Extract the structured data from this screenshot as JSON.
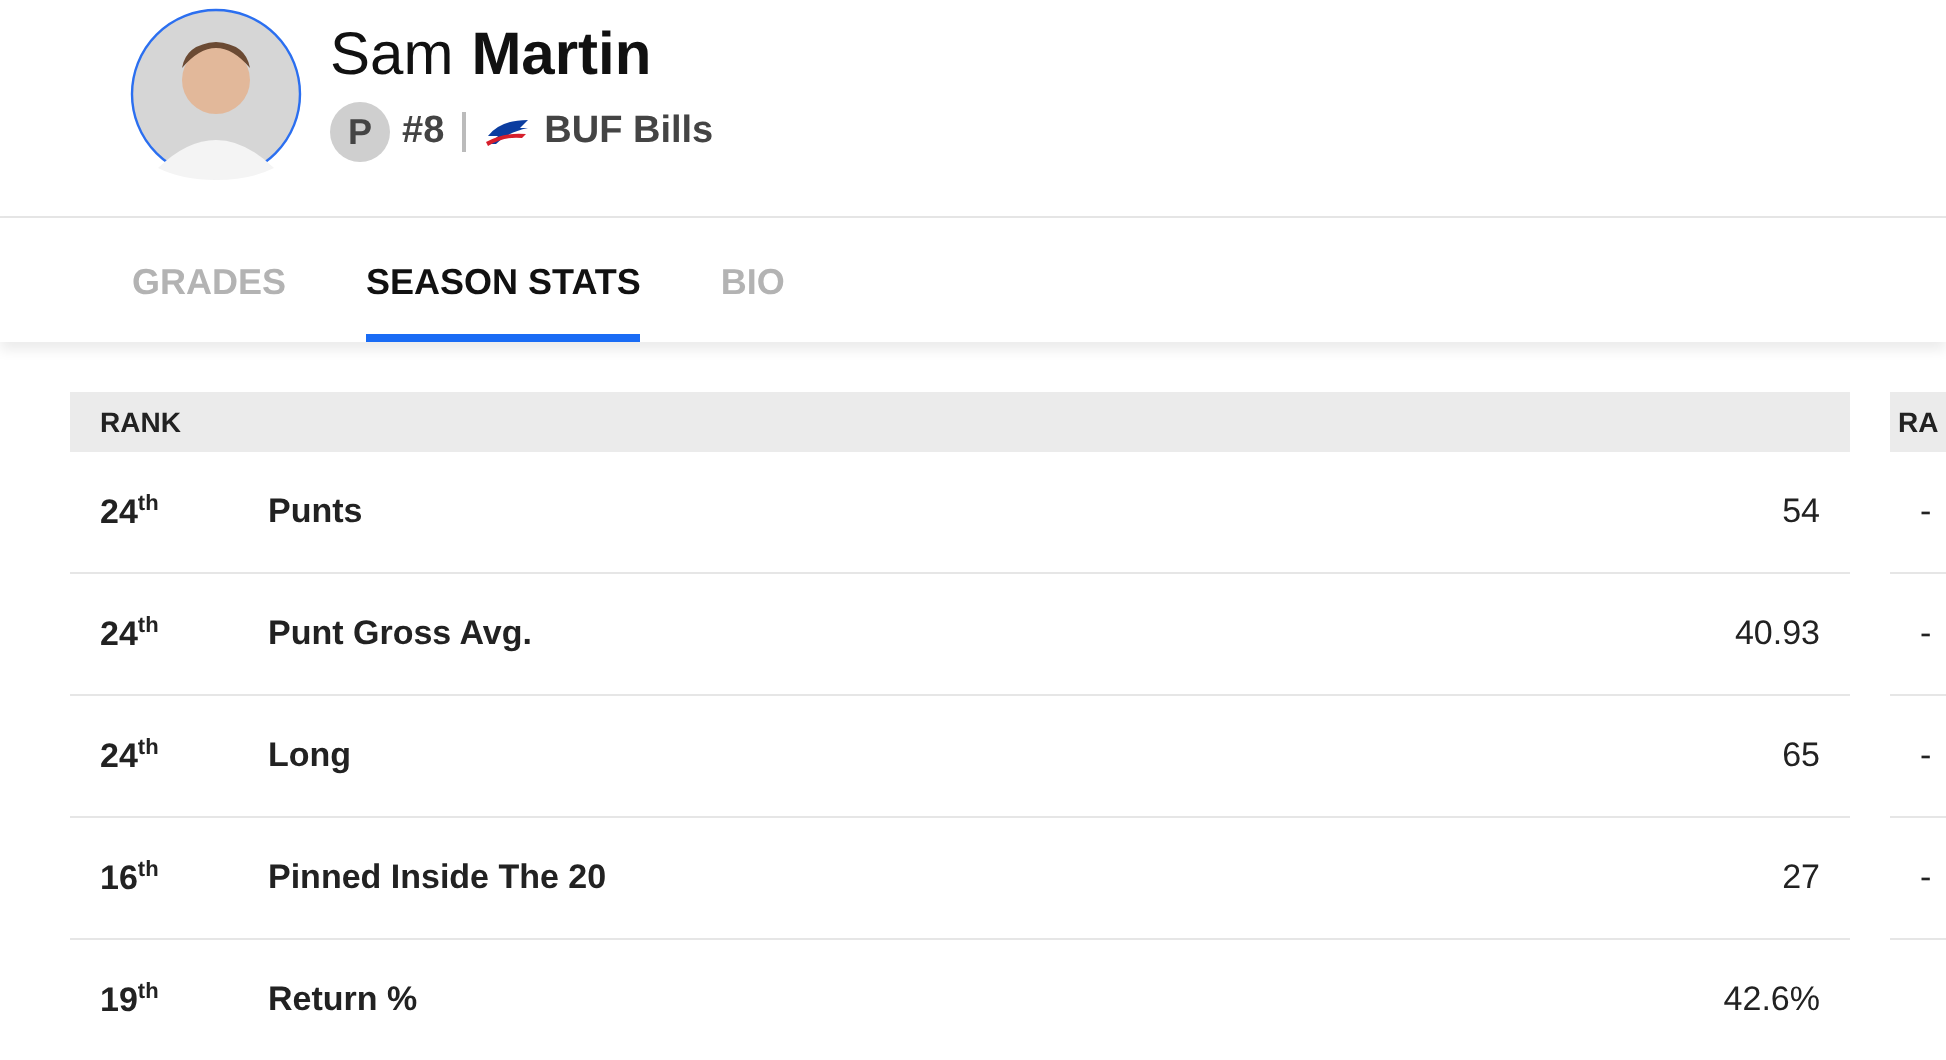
{
  "player": {
    "first_name": "Sam",
    "last_name": "Martin",
    "position": "P",
    "number": "#8",
    "team": "BUF Bills"
  },
  "tabs": [
    {
      "label": "GRADES",
      "selected": false
    },
    {
      "label": "SEASON STATS",
      "selected": true
    },
    {
      "label": "BIO",
      "selected": false
    }
  ],
  "stats_table": {
    "header": "RANK",
    "rows": [
      {
        "rank": "24$^{th}$",
        "stat": "Punts",
        "value": "54"
      },
      {
        "rank": "24$^{th}$",
        "stat": "Punt Gross Avg.",
        "value": "40.93"
      },
      {
        "rank": "24$^{th}$",
        "stat": "Long",
        "value": "65"
      },
      {
        "rank": "16$^{th}$",
        "stat": "Pinned Inside The 20",
        "value": "27"
      },
      {
        "rank": "19$^{th}$",
        "stat": "Return %",
        "value": "42.6%"
      }
    ]
  },
  "side_table": {
    "header": "RA",
    "rows": [
      "-",
      "-",
      "-",
      "-",
      null
    ]
  }
}
